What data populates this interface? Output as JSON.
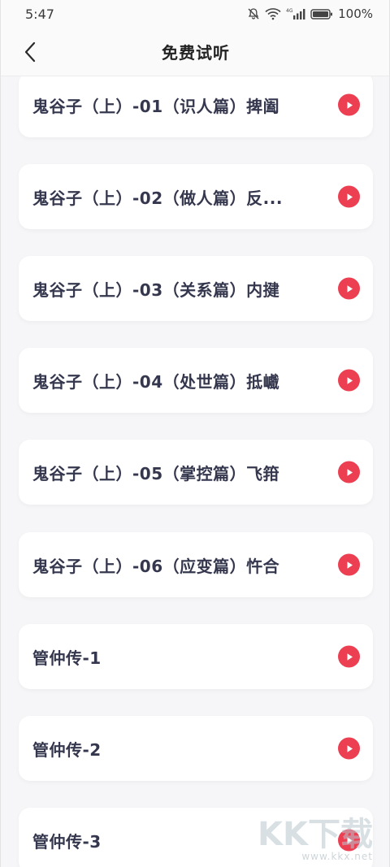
{
  "status_bar": {
    "time": "5:47",
    "network": "4G",
    "battery": "100%"
  },
  "header": {
    "title": "免费试听"
  },
  "items": [
    {
      "title": "鬼谷子（上）-01（识人篇）捭阖"
    },
    {
      "title": "鬼谷子（上）-02（做人篇）反..."
    },
    {
      "title": "鬼谷子（上）-03（关系篇）内揵"
    },
    {
      "title": "鬼谷子（上）-04（处世篇）抵巇"
    },
    {
      "title": "鬼谷子（上）-05（掌控篇）飞箝"
    },
    {
      "title": "鬼谷子（上）-06（应变篇）忤合"
    },
    {
      "title": "管仲传-1"
    },
    {
      "title": "管仲传-2"
    },
    {
      "title": "管仲传-3"
    }
  ],
  "watermark": {
    "brand": "KK下载",
    "url": "www.kkx.net"
  },
  "colors": {
    "accent": "#ec3f52",
    "text": "#35374e",
    "background": "#f6f6f8",
    "card": "#ffffff"
  }
}
